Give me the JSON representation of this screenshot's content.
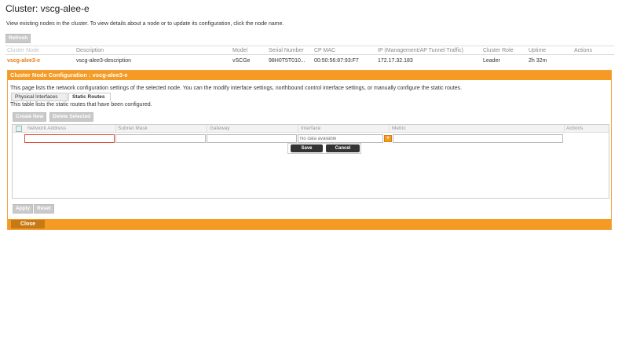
{
  "page": {
    "title": "Cluster: vscg-alee-e",
    "intro": "View existing nodes in the cluster. To view details about a node or to update its configuration, click the node name.",
    "refresh_label": "Refresh"
  },
  "cluster_table": {
    "headers": [
      "Cluster Node",
      "Description",
      "Model",
      "Serial Number",
      "CP MAC",
      "IP (Management/AP Tunnel Traffic)",
      "Cluster Role",
      "Uptime",
      "Actions"
    ],
    "row": {
      "node": "vscg-alee3-e",
      "description": "vscg-alee3-description",
      "model": "vSCGe",
      "serial": "98H0T5T010...",
      "cp_mac": "00:50:56:87:93:F7",
      "ip": "172.17.32.183",
      "role": "Leader",
      "uptime": "2h 32m",
      "actions": ""
    }
  },
  "panel": {
    "title": "Cluster Node Configuration : vscg-alee3-e",
    "description": "This page lists the network configuration settings of the selected node. You can the modify interface settings, northbound control interface settings, or manually configure the static routes.",
    "tabs": [
      {
        "label": "Physical Interfaces"
      },
      {
        "label": "Static Routes"
      }
    ],
    "note": "This table lists the static routes that have been configured.",
    "create_label": "Create New",
    "delete_label": "Delete Selected",
    "grid_headers": [
      "Network Address",
      "Subnet Mask",
      "Gateway",
      "Interface",
      "Metric",
      "Actions"
    ],
    "interface_placeholder": "No data available",
    "save_label": "Save",
    "cancel_label": "Cancel",
    "apply_label": "Apply",
    "reset_label": "Reset",
    "close_label": "Close"
  }
}
